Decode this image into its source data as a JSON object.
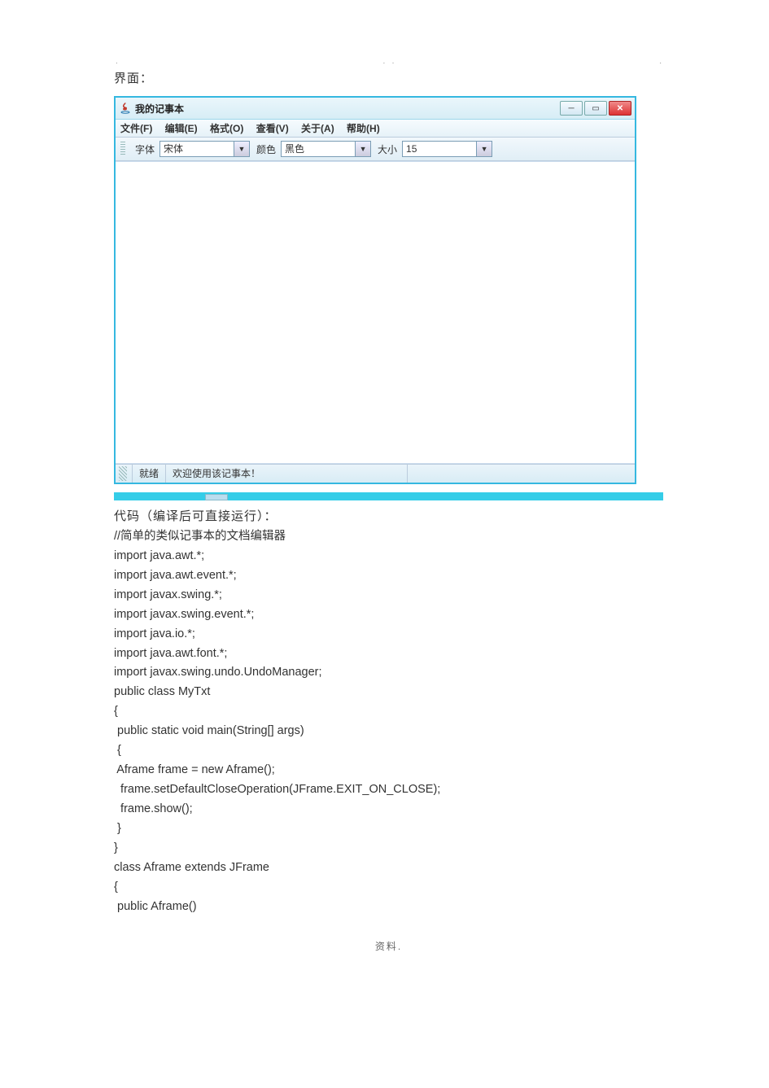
{
  "intro_label": "界面：",
  "window": {
    "title": "我的记事本",
    "menus": {
      "file": "文件(F)",
      "edit": "编辑(E)",
      "format": "格式(O)",
      "view": "查看(V)",
      "about": "关于(A)",
      "help": "帮助(H)"
    },
    "toolbar": {
      "font_label": "字体",
      "font_value": "宋体",
      "color_label": "颜色",
      "color_value": "黑色",
      "size_label": "大小",
      "size_value": "15"
    },
    "status": {
      "ready": "就绪",
      "welcome": "欢迎使用该记事本！"
    }
  },
  "code_label": "代码（编译后可直接运行）：",
  "code_lines": [
    "//简单的类似记事本的文档编辑器",
    "import java.awt.*;",
    "import java.awt.event.*;",
    "import javax.swing.*;",
    "import javax.swing.event.*;",
    "import java.io.*;",
    "import java.awt.font.*;",
    "import javax.swing.undo.UndoManager;",
    "public class MyTxt",
    "{",
    " public static void main(String[] args)",
    " {",
    " Aframe frame = new Aframe();",
    "  frame.setDefaultCloseOperation(JFrame.EXIT_ON_CLOSE);",
    "  frame.show();",
    " }",
    "}",
    "class Aframe extends JFrame",
    "{",
    " public Aframe()"
  ],
  "footer": "资料."
}
